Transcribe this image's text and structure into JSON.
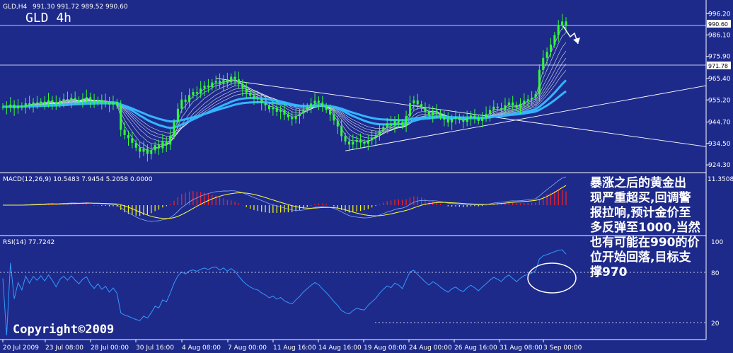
{
  "header": {
    "symbol": "GLD,H4",
    "ohlc": "991.30 991.72 989.52 990.60",
    "big_title": "GLD 4h"
  },
  "macd": {
    "label": "MACD(12,26,9) 10.5483 7.9454 5.2058 0.0000",
    "top_value": "11.3508"
  },
  "rsi": {
    "label": "RSI(14) 77.7242",
    "top_value": "100",
    "levels": [
      "80",
      "20"
    ]
  },
  "annotation": {
    "lines": [
      "暴涨之后的黄金出",
      "现严重超买,回调警",
      "报拉响,预计金价至",
      "多反弹至1000,当然",
      "也有可能在990的价",
      "位开始回落,目标支",
      "撑970"
    ]
  },
  "copyright": "Copyright©2009",
  "colors": {
    "background": "#1e2a8a",
    "candle": "#33ff33",
    "ma_thin": "#ffffff",
    "ma_thick": "#33b5ff",
    "macd_pos": "#ff2020",
    "macd_neg": "#ffff00",
    "signal": "#ffff33",
    "rsi": "#3399ff"
  },
  "chart_data": {
    "type": "candlestick",
    "price_axis": {
      "ticks": [
        996.2,
        986.1,
        975.9,
        965.4,
        955.2,
        944.7,
        934.5,
        924.3
      ],
      "tick_labels": [
        "996.20",
        "986.10",
        "975.90",
        "965.40",
        "955.20",
        "944.70",
        "934.50",
        "924.30"
      ],
      "ylim": [
        922.0,
        998.0
      ],
      "markers": [
        {
          "label": "990.60",
          "value": 990.6
        },
        {
          "label": "971.78",
          "value": 971.78
        }
      ]
    },
    "x_ticks": [
      "20 Jul 2009",
      "23 Jul 08:00",
      "28 Jul 00:00",
      "30 Jul 16:00",
      "4 Aug 08:00",
      "7 Aug 00:00",
      "11 Aug 16:00",
      "14 Aug 16:00",
      "19 Aug 08:00",
      "24 Aug 00:00",
      "26 Aug 16:00",
      "31 Aug 08:00",
      "3 Sep 00:00"
    ],
    "close": [
      952.0,
      951.5,
      953.0,
      951.2,
      952.5,
      951.8,
      953.6,
      952.8,
      954.0,
      953.5,
      954.4,
      953.7,
      955.0,
      954.2,
      953.1,
      954.8,
      955.6,
      954.9,
      956.1,
      955.3,
      954.6,
      955.8,
      956.5,
      955.0,
      954.0,
      955.2,
      953.8,
      954.6,
      953.0,
      954.1,
      952.5,
      941.0,
      938.5,
      937.0,
      934.8,
      932.5,
      930.6,
      932.0,
      929.5,
      931.3,
      933.7,
      932.2,
      935.5,
      934.0,
      938.2,
      944.6,
      951.0,
      955.4,
      954.2,
      957.5,
      959.0,
      958.2,
      960.6,
      962.0,
      961.3,
      963.5,
      964.2,
      962.8,
      965.0,
      963.6,
      966.2,
      965.0,
      962.8,
      960.5,
      958.6,
      957.2,
      956.0,
      955.5,
      953.8,
      952.6,
      950.8,
      951.5,
      949.6,
      950.3,
      948.2,
      947.0,
      946.1,
      947.5,
      948.8,
      950.6,
      952.0,
      953.5,
      954.8,
      954.0,
      952.2,
      950.5,
      948.3,
      945.4,
      942.6,
      938.0,
      935.5,
      934.0,
      935.2,
      936.1,
      935.0,
      934.4,
      936.0,
      937.3,
      938.5,
      940.6,
      942.4,
      944.0,
      943.2,
      945.4,
      944.6,
      943.0,
      947.5,
      953.6,
      955.0,
      953.2,
      951.5,
      949.6,
      948.0,
      950.1,
      949.0,
      947.3,
      945.8,
      944.5,
      946.2,
      947.1,
      945.6,
      944.8,
      946.5,
      947.8,
      946.6,
      945.2,
      946.9,
      948.5,
      950.4,
      952.0,
      951.3,
      950.4,
      952.6,
      954.0,
      952.8,
      951.6,
      953.4,
      954.8,
      955.5,
      956.3,
      957.9,
      969.5,
      975.2,
      978.0,
      981.5,
      986.0,
      990.6,
      992.5,
      990.6
    ],
    "title": "GLD 4h"
  }
}
